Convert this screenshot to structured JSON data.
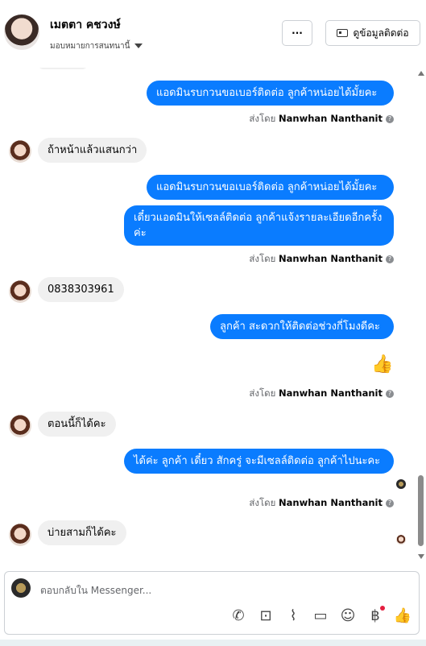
{
  "header": {
    "name": "เมตตา คชวงษ์",
    "assign": "มอบหมายการสนทนานี้",
    "more_label": "···",
    "info_label": "ดูข้อมูลติดต่อ"
  },
  "messages": {
    "m1": "แอดมินรบกวนขอเบอร์ติดต่อ ลูกค้าหน่อยได้มั้ยคะ",
    "m2": "ถ้าหน้าแล้วแสนกว่า",
    "m3": "แอดมินรบกวนขอเบอร์ติดต่อ ลูกค้าหน่อยได้มั้ยคะ",
    "m4": "เดี๋ยวแอดมินให้เซลล์ติดต่อ ลูกค้าแจ้งรายละเอียดอีกครั้ง ค่ะ",
    "m5": "0838303961",
    "m6": "ลูกค้า สะดวกให้ติดต่อช่วงกี่โมงดีคะ",
    "m7": "ตอนนี้ก็ได้คะ",
    "m8": "ได้ค่ะ ลูกค้า เดี๋ยว สักครู่ จะมีเซลล์ติดต่อ ลูกค้าไปนะคะ",
    "m9": "บ่ายสามก็ได้คะ"
  },
  "sent_by": {
    "prefix": "ส่งโดย",
    "name": "Nanwhan Nanthanit"
  },
  "composer": {
    "placeholder": "ตอบกลับใน Messenger..."
  },
  "icons": [
    "ellipsis-icon",
    "contact-card-icon",
    "thumbs-up-icon",
    "help-icon",
    "call-add-icon",
    "bag-icon",
    "attachment-icon",
    "chat-icon",
    "emoji-icon",
    "baht-icon",
    "thumbs-up-send-icon"
  ],
  "colors": {
    "accent": "#0a7cff",
    "incoming": "#f0f0f0"
  }
}
